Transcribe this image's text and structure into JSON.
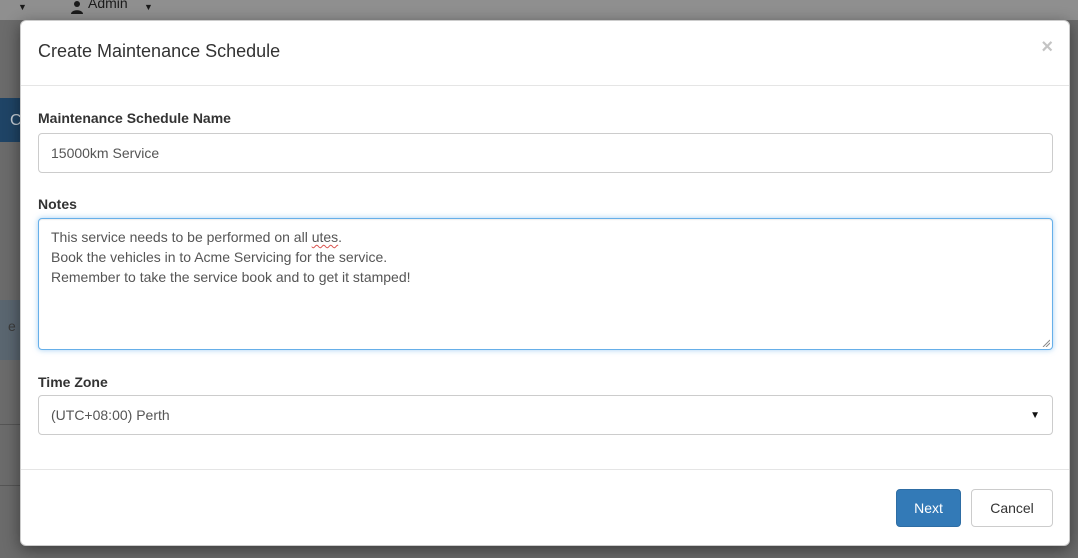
{
  "background": {
    "nav_admin": "Admin",
    "left_letter_top": "C",
    "left_letter_mid": "e"
  },
  "modal": {
    "title": "Create Maintenance Schedule",
    "close_glyph": "×",
    "name_label": "Maintenance Schedule Name",
    "name_value": "15000km Service",
    "notes_label": "Notes",
    "notes_lines": [
      "This service needs to be performed on all ",
      "Book the vehicles in to Acme Servicing for the service.",
      "Remember to take the service book and to get it stamped!"
    ],
    "notes_misspelled_word": "utes",
    "notes_line1_end": ".",
    "timezone_label": "Time Zone",
    "timezone_value": "(UTC+08:00) Perth",
    "next_label": "Next",
    "cancel_label": "Cancel"
  },
  "colors": {
    "primary": "#337ab7",
    "focus_border": "#66afe9",
    "overlay": "#6b6b6b"
  },
  "icons": [
    "user-icon",
    "close-icon",
    "caret-down-icon",
    "resize-grip-icon"
  ]
}
